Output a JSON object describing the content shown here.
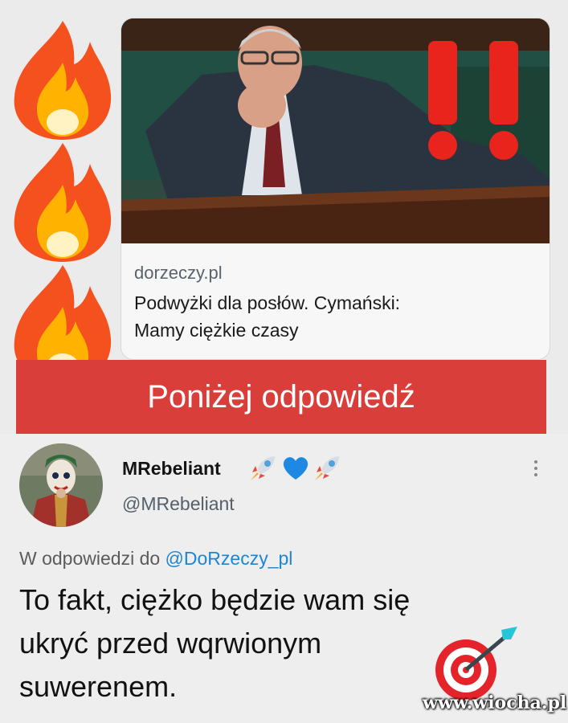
{
  "link_card": {
    "domain": "dorzeczy.pl",
    "title_line1": "Podwyżki dla posłów. Cymański:",
    "title_line2": "Mamy ciężkie czasy"
  },
  "banner": {
    "text": "Poniżej odpowiedź"
  },
  "tweet": {
    "display_name": "MRebeliant",
    "name_emojis": [
      "rocket-icon",
      "blue-heart-icon",
      "rocket-icon"
    ],
    "handle": "@MRebeliant",
    "reply_prefix": "W odpowiedzi do",
    "reply_mention": "@DoRzeczy_pl",
    "text_line1": "To fakt, ciężko będzie wam się",
    "text_line2": "ukryć przed wqrwionym",
    "text_line3": "suwerenem."
  },
  "decorations": {
    "fire_count": 3,
    "exclamation": "!!",
    "target_emoji": "direct-hit-icon"
  },
  "watermark": "www.wiocha.pl",
  "colors": {
    "banner_red": "#d93e3b",
    "mention_blue": "#1d86cf",
    "page_bg": "#ebebeb"
  }
}
